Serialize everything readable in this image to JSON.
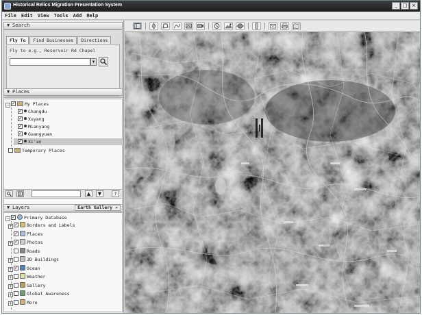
{
  "window": {
    "title": "Historical Relics Migration Presentation System",
    "controls": [
      "_",
      "□",
      "×"
    ]
  },
  "menu": [
    "File",
    "Edit",
    "View",
    "Tools",
    "Add",
    "Help"
  ],
  "search": {
    "header": "Search",
    "tabs": [
      "Fly To",
      "Find Businesses",
      "Directions"
    ],
    "hint": "Fly  to  e.g.,  Reservoir  Rd  Chapel",
    "input_value": "",
    "dropdown_glyph": "▼"
  },
  "places": {
    "header": "Places",
    "my_places": "My Places",
    "items": [
      "Changdu",
      "Xuyang",
      "Mianyang",
      "Guangyuan",
      "Xi'an"
    ],
    "selected_index": 4,
    "temporary": "Temporary Places"
  },
  "places_toolbar": {
    "up": "▲",
    "down": "▼",
    "help": "?"
  },
  "layers": {
    "header": "Layers",
    "gallery_button": "Earth Gallery »",
    "primary_database": "Primary Database",
    "items": [
      {
        "label": "Borders and Labels",
        "checked": true,
        "expandable": true,
        "icon": "flag-icon",
        "color": "#d8c070"
      },
      {
        "label": "Places",
        "checked": true,
        "expandable": false,
        "icon": "places-icon",
        "color": "#a8c0e0"
      },
      {
        "label": "Photos",
        "checked": true,
        "expandable": true,
        "icon": "photo-icon",
        "color": "#d0d0d0"
      },
      {
        "label": "Roads",
        "checked": false,
        "expandable": false,
        "icon": "road-icon",
        "color": "#888888"
      },
      {
        "label": "3D Buildings",
        "checked": false,
        "expandable": true,
        "icon": "building-icon",
        "color": "#c0c0c0"
      },
      {
        "label": "Ocean",
        "checked": true,
        "expandable": true,
        "icon": "ocean-icon",
        "color": "#5080c0"
      },
      {
        "label": "Weather",
        "checked": false,
        "expandable": true,
        "icon": "weather-icon",
        "color": "#e0e0a0"
      },
      {
        "label": "Gallery",
        "checked": false,
        "expandable": true,
        "icon": "gallery-icon",
        "color": "#c0a060"
      },
      {
        "label": "Global Awareness",
        "checked": false,
        "expandable": true,
        "icon": "globe-icon",
        "color": "#70a070"
      },
      {
        "label": "More",
        "checked": false,
        "expandable": true,
        "icon": "more-icon",
        "color": "#d0b080"
      }
    ]
  },
  "toolbar": {
    "icons": [
      "sidebar-toggle-icon",
      "placemark-icon",
      "polygon-icon",
      "path-icon",
      "image-overlay-icon",
      "record-tour-icon",
      "historical-imagery-icon",
      "sun-icon",
      "planets-icon",
      "ruler-icon",
      "email-icon",
      "print-icon",
      "view-in-maps-icon"
    ]
  },
  "colors": {
    "title_bar": "#2a2a2a",
    "panel_bg": "#ececec",
    "map_base": "#4f4f4f",
    "selection": "#c8c8c8"
  }
}
